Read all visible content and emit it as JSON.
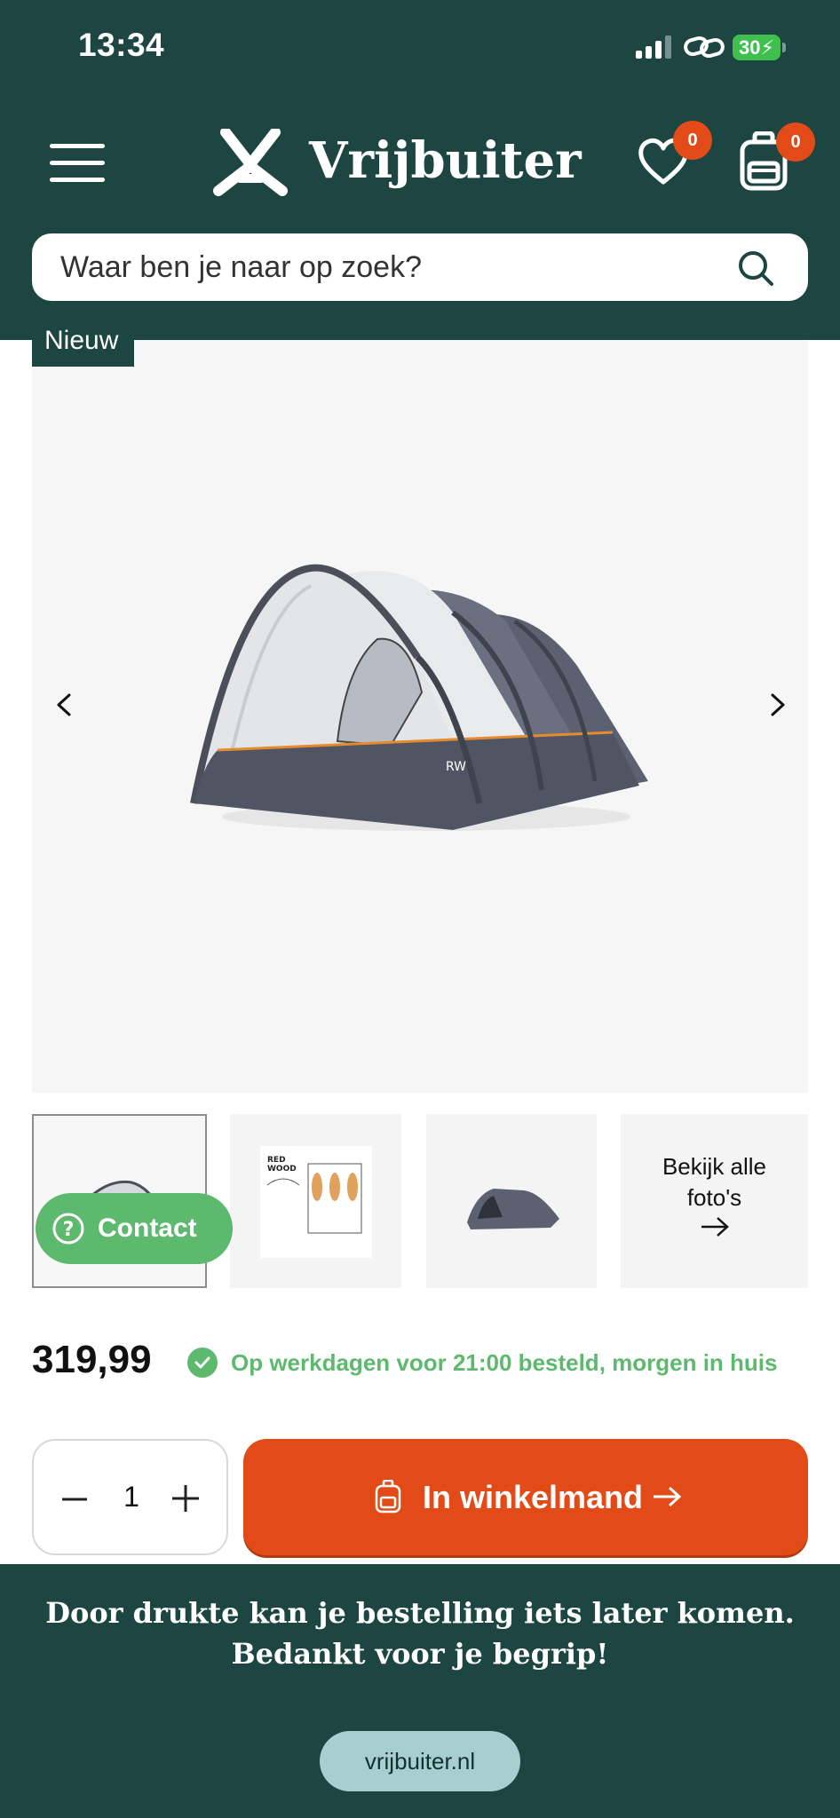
{
  "status_bar": {
    "time": "13:34",
    "battery": "30"
  },
  "header": {
    "logo_text": "Vrijbuiter",
    "wishlist_count": "0",
    "cart_count": "0",
    "search_placeholder": "Waar ben je naar op zoek?"
  },
  "gallery": {
    "badge": "Nieuw",
    "view_all_line1": "Bekijk alle",
    "view_all_line2": "foto's"
  },
  "contact": {
    "label": "Contact"
  },
  "product": {
    "price": "319,99",
    "delivery": "Op werkdagen voor 21:00 besteld, morgen in huis",
    "quantity": "1",
    "add_to_cart": "In winkelmand"
  },
  "notice": {
    "line1": "Door drukte kan je bestelling iets later komen.",
    "line2": "Bedankt voor je begrip!"
  },
  "browser": {
    "url": "vrijbuiter.nl"
  },
  "colors": {
    "brand_green": "#1d4643",
    "accent_orange": "#e24b17",
    "success_green": "#5db96d",
    "url_pill": "#a8cfcf"
  }
}
